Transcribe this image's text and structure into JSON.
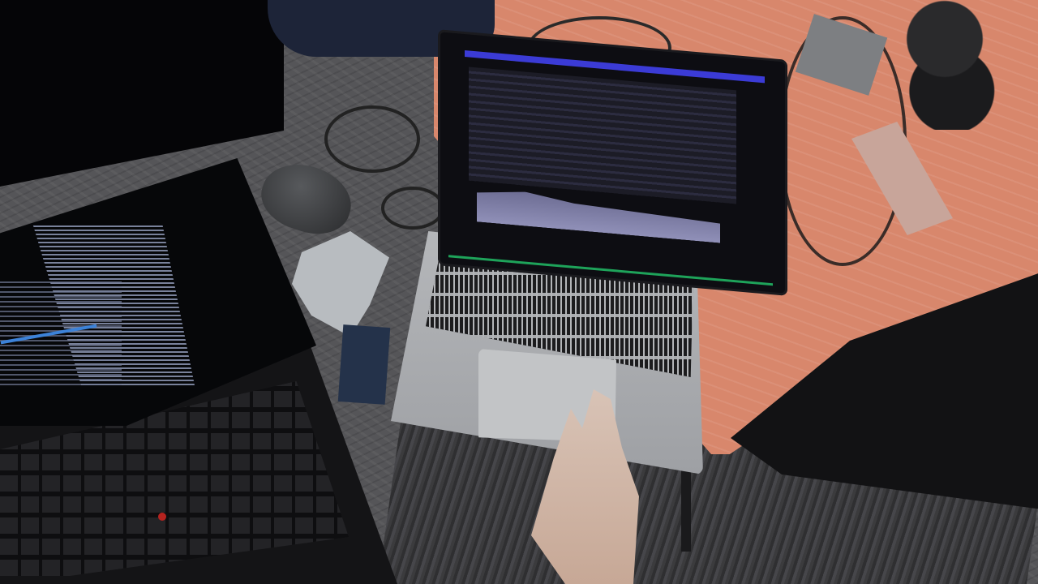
{
  "scene": {
    "alt": ""
  }
}
